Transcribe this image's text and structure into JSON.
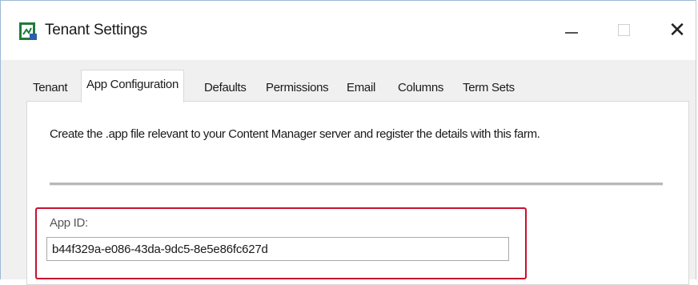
{
  "window": {
    "title": "Tenant Settings",
    "controls": {
      "minimize": "—",
      "maximize": "",
      "close": "✕"
    }
  },
  "tabs": [
    {
      "label": "Tenant",
      "active": false
    },
    {
      "label": "App Configuration",
      "active": true
    },
    {
      "label": "Defaults",
      "active": false
    },
    {
      "label": "Permissions",
      "active": false
    },
    {
      "label": "Email",
      "active": false
    },
    {
      "label": "Columns",
      "active": false
    },
    {
      "label": "Term Sets",
      "active": false
    }
  ],
  "panel": {
    "description": "Create the .app file relevant to your Content Manager server and register the details with this farm.",
    "app_id": {
      "label": "App ID:",
      "value": "b44f329a-e086-43da-9dc5-8e5e86fc627d"
    }
  },
  "colors": {
    "highlight": "#c8102e",
    "window_bg": "#f0f0f0",
    "panel_bg": "#ffffff"
  }
}
